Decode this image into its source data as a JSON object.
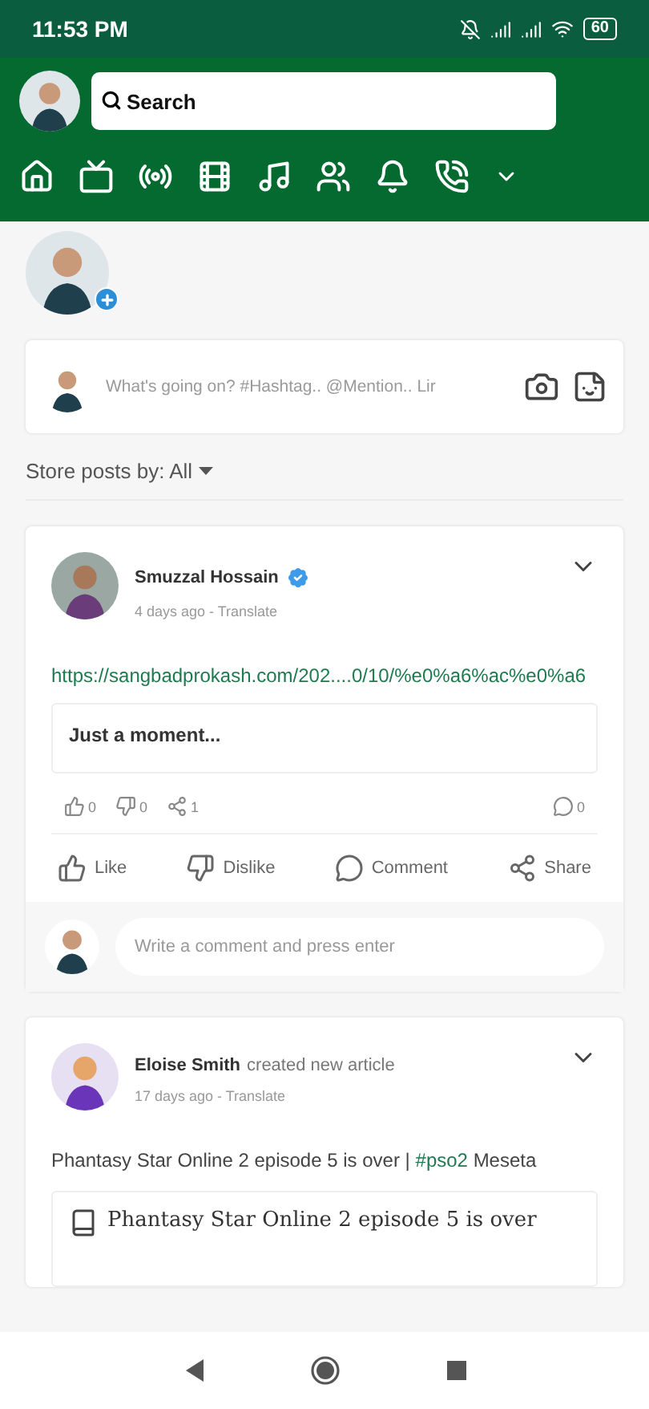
{
  "status_bar": {
    "time": "11:53 PM",
    "battery": "60"
  },
  "header": {
    "search": {
      "placeholder": "Search"
    }
  },
  "composer": {
    "placeholder": "What's going on? #Hashtag.. @Mention.. Lir"
  },
  "sort": {
    "label": "Store posts by: All"
  },
  "posts": [
    {
      "kind": "link",
      "author": "Smuzzal Hossain",
      "verified": true,
      "meta": "4 days ago - Translate",
      "link": "https://sangbadprokash.com/202....0/10/%e0%a6%ac%e0%a6",
      "preview_title": "Just a moment...",
      "likes": "0",
      "dislikes": "0",
      "shares": "1",
      "comments": "0",
      "actions": [
        "Like",
        "Dislike",
        "Comment",
        "Share"
      ],
      "comment_placeholder": "Write a comment and press enter"
    },
    {
      "kind": "article",
      "author": "Eloise Smith",
      "verified": false,
      "activity": "created new article",
      "meta": "17 days ago - Translate",
      "text": "Phantasy Star Online 2 episode 5 is over |",
      "hashtag": "#pso2",
      "text_after": "Meseta",
      "article_title": "Phantasy Star Online 2 episode 5 is over"
    }
  ]
}
